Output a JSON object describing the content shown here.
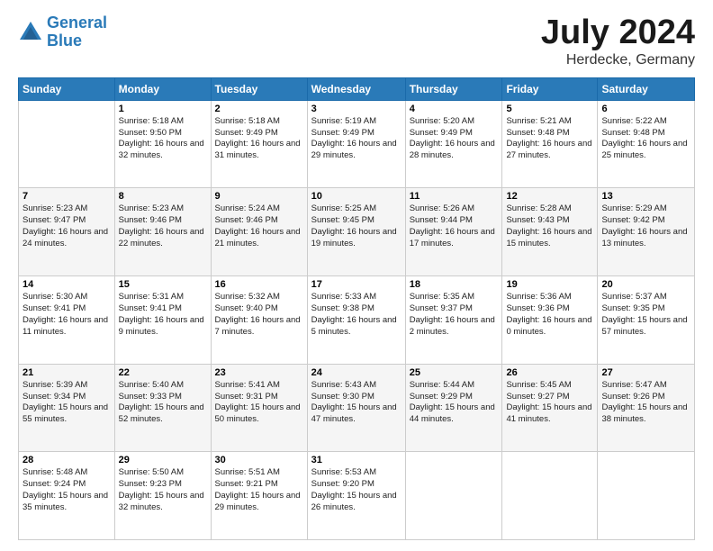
{
  "header": {
    "logo_line1": "General",
    "logo_line2": "Blue",
    "main_title": "July 2024",
    "subtitle": "Herdecke, Germany"
  },
  "calendar": {
    "days_of_week": [
      "Sunday",
      "Monday",
      "Tuesday",
      "Wednesday",
      "Thursday",
      "Friday",
      "Saturday"
    ],
    "weeks": [
      [
        {
          "day": "",
          "sunrise": "",
          "sunset": "",
          "daylight": ""
        },
        {
          "day": "1",
          "sunrise": "Sunrise: 5:18 AM",
          "sunset": "Sunset: 9:50 PM",
          "daylight": "Daylight: 16 hours and 32 minutes."
        },
        {
          "day": "2",
          "sunrise": "Sunrise: 5:18 AM",
          "sunset": "Sunset: 9:49 PM",
          "daylight": "Daylight: 16 hours and 31 minutes."
        },
        {
          "day": "3",
          "sunrise": "Sunrise: 5:19 AM",
          "sunset": "Sunset: 9:49 PM",
          "daylight": "Daylight: 16 hours and 29 minutes."
        },
        {
          "day": "4",
          "sunrise": "Sunrise: 5:20 AM",
          "sunset": "Sunset: 9:49 PM",
          "daylight": "Daylight: 16 hours and 28 minutes."
        },
        {
          "day": "5",
          "sunrise": "Sunrise: 5:21 AM",
          "sunset": "Sunset: 9:48 PM",
          "daylight": "Daylight: 16 hours and 27 minutes."
        },
        {
          "day": "6",
          "sunrise": "Sunrise: 5:22 AM",
          "sunset": "Sunset: 9:48 PM",
          "daylight": "Daylight: 16 hours and 25 minutes."
        }
      ],
      [
        {
          "day": "7",
          "sunrise": "Sunrise: 5:23 AM",
          "sunset": "Sunset: 9:47 PM",
          "daylight": "Daylight: 16 hours and 24 minutes."
        },
        {
          "day": "8",
          "sunrise": "Sunrise: 5:23 AM",
          "sunset": "Sunset: 9:46 PM",
          "daylight": "Daylight: 16 hours and 22 minutes."
        },
        {
          "day": "9",
          "sunrise": "Sunrise: 5:24 AM",
          "sunset": "Sunset: 9:46 PM",
          "daylight": "Daylight: 16 hours and 21 minutes."
        },
        {
          "day": "10",
          "sunrise": "Sunrise: 5:25 AM",
          "sunset": "Sunset: 9:45 PM",
          "daylight": "Daylight: 16 hours and 19 minutes."
        },
        {
          "day": "11",
          "sunrise": "Sunrise: 5:26 AM",
          "sunset": "Sunset: 9:44 PM",
          "daylight": "Daylight: 16 hours and 17 minutes."
        },
        {
          "day": "12",
          "sunrise": "Sunrise: 5:28 AM",
          "sunset": "Sunset: 9:43 PM",
          "daylight": "Daylight: 16 hours and 15 minutes."
        },
        {
          "day": "13",
          "sunrise": "Sunrise: 5:29 AM",
          "sunset": "Sunset: 9:42 PM",
          "daylight": "Daylight: 16 hours and 13 minutes."
        }
      ],
      [
        {
          "day": "14",
          "sunrise": "Sunrise: 5:30 AM",
          "sunset": "Sunset: 9:41 PM",
          "daylight": "Daylight: 16 hours and 11 minutes."
        },
        {
          "day": "15",
          "sunrise": "Sunrise: 5:31 AM",
          "sunset": "Sunset: 9:41 PM",
          "daylight": "Daylight: 16 hours and 9 minutes."
        },
        {
          "day": "16",
          "sunrise": "Sunrise: 5:32 AM",
          "sunset": "Sunset: 9:40 PM",
          "daylight": "Daylight: 16 hours and 7 minutes."
        },
        {
          "day": "17",
          "sunrise": "Sunrise: 5:33 AM",
          "sunset": "Sunset: 9:38 PM",
          "daylight": "Daylight: 16 hours and 5 minutes."
        },
        {
          "day": "18",
          "sunrise": "Sunrise: 5:35 AM",
          "sunset": "Sunset: 9:37 PM",
          "daylight": "Daylight: 16 hours and 2 minutes."
        },
        {
          "day": "19",
          "sunrise": "Sunrise: 5:36 AM",
          "sunset": "Sunset: 9:36 PM",
          "daylight": "Daylight: 16 hours and 0 minutes."
        },
        {
          "day": "20",
          "sunrise": "Sunrise: 5:37 AM",
          "sunset": "Sunset: 9:35 PM",
          "daylight": "Daylight: 15 hours and 57 minutes."
        }
      ],
      [
        {
          "day": "21",
          "sunrise": "Sunrise: 5:39 AM",
          "sunset": "Sunset: 9:34 PM",
          "daylight": "Daylight: 15 hours and 55 minutes."
        },
        {
          "day": "22",
          "sunrise": "Sunrise: 5:40 AM",
          "sunset": "Sunset: 9:33 PM",
          "daylight": "Daylight: 15 hours and 52 minutes."
        },
        {
          "day": "23",
          "sunrise": "Sunrise: 5:41 AM",
          "sunset": "Sunset: 9:31 PM",
          "daylight": "Daylight: 15 hours and 50 minutes."
        },
        {
          "day": "24",
          "sunrise": "Sunrise: 5:43 AM",
          "sunset": "Sunset: 9:30 PM",
          "daylight": "Daylight: 15 hours and 47 minutes."
        },
        {
          "day": "25",
          "sunrise": "Sunrise: 5:44 AM",
          "sunset": "Sunset: 9:29 PM",
          "daylight": "Daylight: 15 hours and 44 minutes."
        },
        {
          "day": "26",
          "sunrise": "Sunrise: 5:45 AM",
          "sunset": "Sunset: 9:27 PM",
          "daylight": "Daylight: 15 hours and 41 minutes."
        },
        {
          "day": "27",
          "sunrise": "Sunrise: 5:47 AM",
          "sunset": "Sunset: 9:26 PM",
          "daylight": "Daylight: 15 hours and 38 minutes."
        }
      ],
      [
        {
          "day": "28",
          "sunrise": "Sunrise: 5:48 AM",
          "sunset": "Sunset: 9:24 PM",
          "daylight": "Daylight: 15 hours and 35 minutes."
        },
        {
          "day": "29",
          "sunrise": "Sunrise: 5:50 AM",
          "sunset": "Sunset: 9:23 PM",
          "daylight": "Daylight: 15 hours and 32 minutes."
        },
        {
          "day": "30",
          "sunrise": "Sunrise: 5:51 AM",
          "sunset": "Sunset: 9:21 PM",
          "daylight": "Daylight: 15 hours and 29 minutes."
        },
        {
          "day": "31",
          "sunrise": "Sunrise: 5:53 AM",
          "sunset": "Sunset: 9:20 PM",
          "daylight": "Daylight: 15 hours and 26 minutes."
        },
        {
          "day": "",
          "sunrise": "",
          "sunset": "",
          "daylight": ""
        },
        {
          "day": "",
          "sunrise": "",
          "sunset": "",
          "daylight": ""
        },
        {
          "day": "",
          "sunrise": "",
          "sunset": "",
          "daylight": ""
        }
      ]
    ]
  }
}
